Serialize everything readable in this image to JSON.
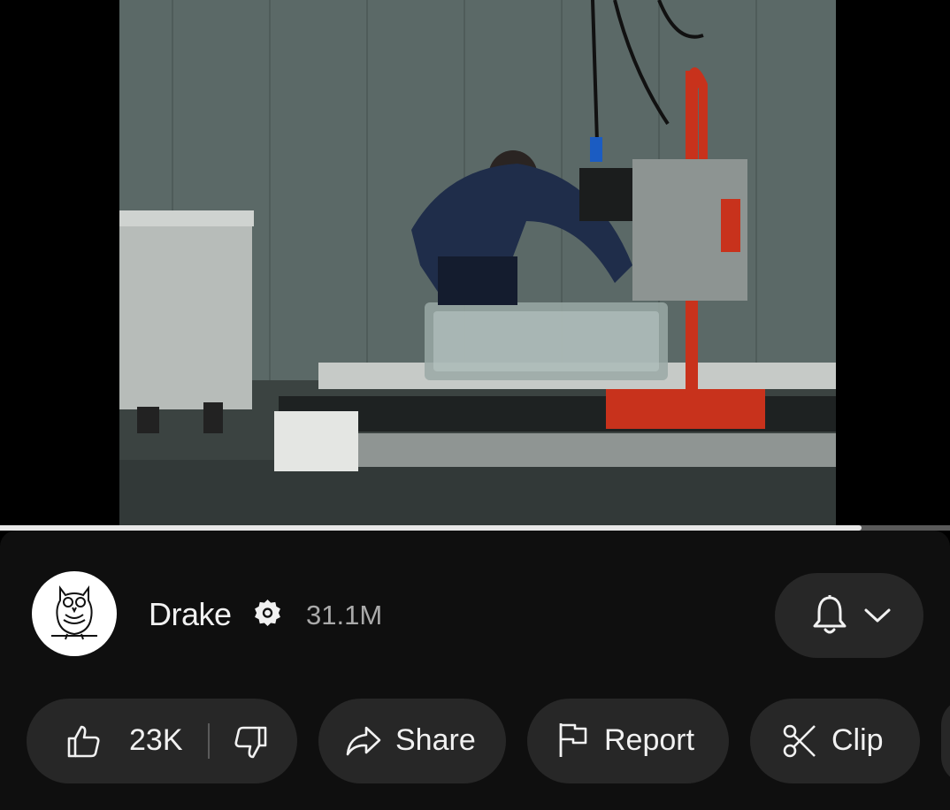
{
  "player": {
    "progress_fraction": 0.907
  },
  "channel": {
    "name": "Drake",
    "subscribers": "31.1M",
    "verified": true
  },
  "actions": {
    "like_count": "23K",
    "share_label": "Share",
    "report_label": "Report",
    "clip_label": "Clip"
  },
  "colors": {
    "panel_bg": "#0f0f0f",
    "pill_bg": "#272727",
    "text_primary": "#f1f1f1",
    "text_secondary": "#aaaaaa",
    "progress_fill": "#e8e8e8",
    "progress_track": "#5a5a5a",
    "machine_red": "#c8321c"
  },
  "icons": {
    "avatar": "owl-logo-icon",
    "verified": "verified-badge-icon",
    "bell": "bell-icon",
    "dropdown": "chevron-down-icon",
    "like": "thumbs-up-icon",
    "dislike": "thumbs-down-icon",
    "share": "share-arrow-icon",
    "report": "flag-icon",
    "clip": "scissors-icon"
  }
}
